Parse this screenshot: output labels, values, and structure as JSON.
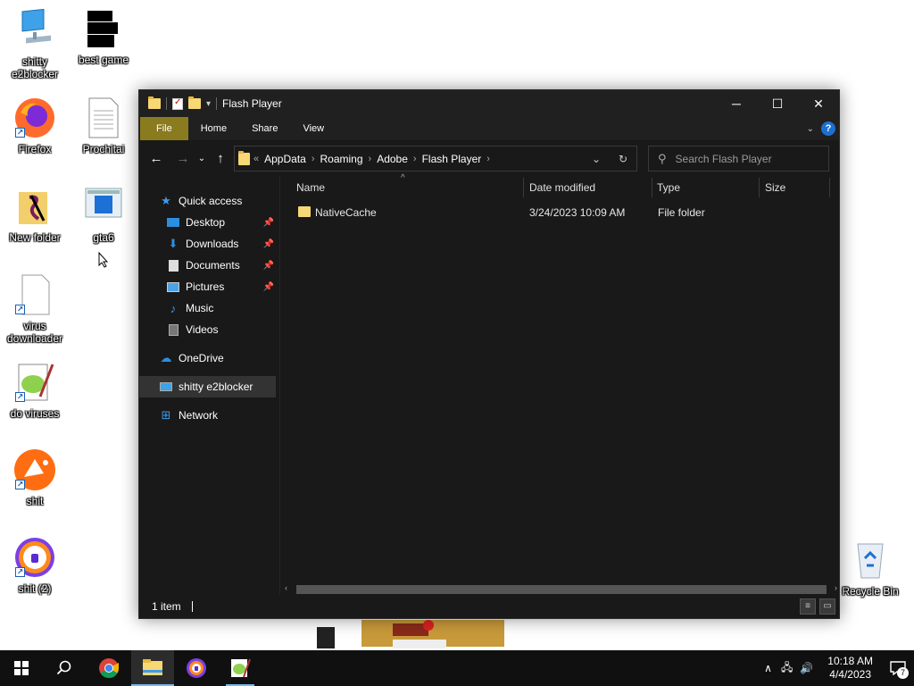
{
  "desktop": {
    "icons": [
      {
        "label": "shitty e2blocker"
      },
      {
        "label": "best game"
      },
      {
        "label": "Firefox"
      },
      {
        "label": "Prochitai"
      },
      {
        "label": "New folder"
      },
      {
        "label": "gta6"
      },
      {
        "label": "virus downloader"
      },
      {
        "label": "do viruses"
      },
      {
        "label": "shit"
      },
      {
        "label": "shit (2)"
      },
      {
        "label": "Recycle Bin"
      }
    ]
  },
  "window": {
    "title": "Flash Player",
    "ribbon_tabs": [
      "File",
      "Home",
      "Share",
      "View"
    ],
    "breadcrumb": [
      "AppData",
      "Roaming",
      "Adobe",
      "Flash Player"
    ],
    "breadcrumb_prefix": "«",
    "search_placeholder": "Search Flash Player",
    "nav": {
      "quick_access": "Quick access",
      "items": [
        "Desktop",
        "Downloads",
        "Documents",
        "Pictures",
        "Music",
        "Videos"
      ],
      "onedrive": "OneDrive",
      "this_pc": "shitty e2blocker",
      "network": "Network"
    },
    "columns": [
      "Name",
      "Date modified",
      "Type",
      "Size"
    ],
    "files": [
      {
        "name": "NativeCache",
        "date": "3/24/2023 10:09 AM",
        "type": "File folder",
        "size": ""
      }
    ],
    "status": "1 item"
  },
  "taskbar": {
    "time": "10:18 AM",
    "date": "4/4/2023",
    "notification_count": "7"
  },
  "colors": {
    "window_bg": "#191919",
    "titlebar": "#202020",
    "file_tab": "#8a7b1f",
    "taskbar": "#101010",
    "accent": "#76b9ed"
  }
}
